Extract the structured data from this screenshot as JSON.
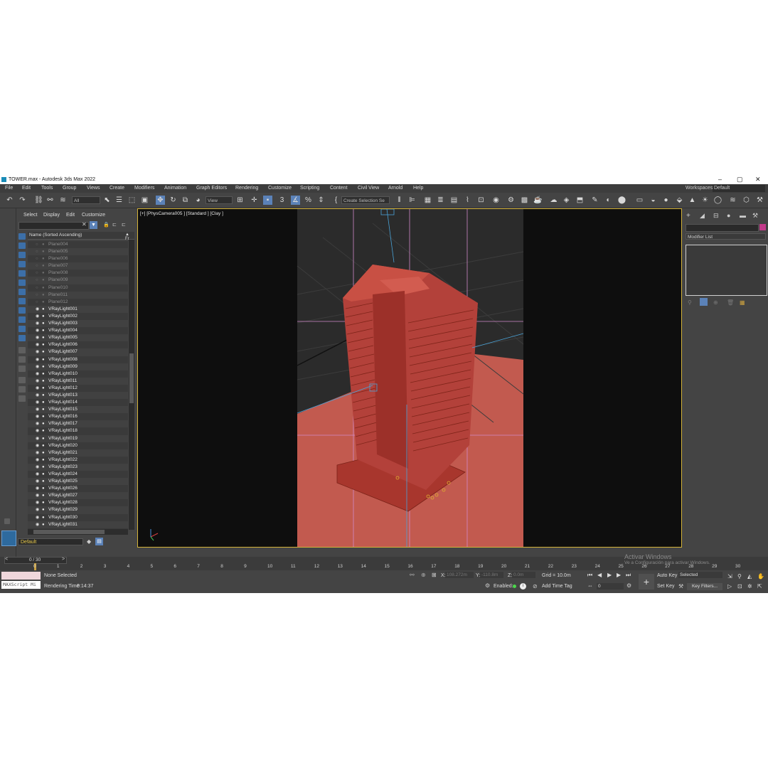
{
  "window": {
    "title": "TOWER.max - Autodesk 3ds Max 2022",
    "controls": [
      "–",
      "▢",
      "✕"
    ]
  },
  "menu": [
    "File",
    "Edit",
    "Tools",
    "Group",
    "Views",
    "Create",
    "Modifiers",
    "Animation",
    "Graph Editors",
    "Rendering",
    "Customize",
    "Scripting",
    "Content",
    "Civil View",
    "Arnold",
    "Help"
  ],
  "workspace": {
    "label": "Workspaces:",
    "value": "Default"
  },
  "toolbar": {
    "selection_filter": "All",
    "ref_coord": "View",
    "named_selection": "Create Selection Se"
  },
  "scene_explorer": {
    "tabs": [
      "Select",
      "Display",
      "Edit",
      "Customize"
    ],
    "column_header": "Name (Sorted Ascending)",
    "column_header_right": "Fr",
    "layer": "Default",
    "items": [
      {
        "name": "Plane004",
        "dim": true
      },
      {
        "name": "Plane005",
        "dim": true
      },
      {
        "name": "Plane006",
        "dim": true
      },
      {
        "name": "Plane007",
        "dim": true
      },
      {
        "name": "Plane008",
        "dim": true
      },
      {
        "name": "Plane009",
        "dim": true
      },
      {
        "name": "Plane010",
        "dim": true
      },
      {
        "name": "Plane011",
        "dim": true
      },
      {
        "name": "Plane012",
        "dim": true
      },
      {
        "name": "VRayLight001"
      },
      {
        "name": "VRayLight002"
      },
      {
        "name": "VRayLight003"
      },
      {
        "name": "VRayLight004"
      },
      {
        "name": "VRayLight005"
      },
      {
        "name": "VRayLight006"
      },
      {
        "name": "VRayLight007"
      },
      {
        "name": "VRayLight008"
      },
      {
        "name": "VRayLight009"
      },
      {
        "name": "VRayLight010"
      },
      {
        "name": "VRayLight011"
      },
      {
        "name": "VRayLight012"
      },
      {
        "name": "VRayLight013"
      },
      {
        "name": "VRayLight014"
      },
      {
        "name": "VRayLight015"
      },
      {
        "name": "VRayLight016"
      },
      {
        "name": "VRayLight017"
      },
      {
        "name": "VRayLight018"
      },
      {
        "name": "VRayLight019"
      },
      {
        "name": "VRayLight020"
      },
      {
        "name": "VRayLight021"
      },
      {
        "name": "VRayLight022"
      },
      {
        "name": "VRayLight023"
      },
      {
        "name": "VRayLight024"
      },
      {
        "name": "VRayLight025"
      },
      {
        "name": "VRayLight026"
      },
      {
        "name": "VRayLight027"
      },
      {
        "name": "VRayLight028"
      },
      {
        "name": "VRayLight029"
      },
      {
        "name": "VRayLight030"
      },
      {
        "name": "VRayLight031"
      }
    ]
  },
  "viewport": {
    "label": "[+] [PhysCamera005 ] [Standard ] [Clay ]"
  },
  "command_panel": {
    "modifier_list": "Modifier List"
  },
  "timeline": {
    "frame_range": "0 / 30",
    "ticks": [
      "0",
      "1",
      "2",
      "3",
      "4",
      "5",
      "6",
      "7",
      "8",
      "9",
      "10",
      "11",
      "12",
      "13",
      "14",
      "15",
      "16",
      "17",
      "18",
      "19",
      "20",
      "21",
      "22",
      "23",
      "24",
      "25",
      "26",
      "27",
      "28",
      "29",
      "30"
    ]
  },
  "status": {
    "maxscript": "MAXScript Mi",
    "selection": "None Selected",
    "render_time_label": "Rendering Time",
    "render_time": "0:14:37",
    "x_label": "X:",
    "x_value": "108.272m",
    "y_label": "Y:",
    "y_value": "-110.8m",
    "z_label": "Z:",
    "z_value": "0.0m",
    "grid": "Grid = 10.0m",
    "enabled_label": "Enabled:",
    "add_time_tag": "Add Time Tag",
    "auto_key": "Auto Key",
    "selected": "Selected",
    "set_key": "Set Key",
    "key_filters": "Key Filters...",
    "frame_field": "0"
  },
  "watermark": {
    "line1": "Activar Windows",
    "line2": "Ve a Configuración para activar Windows."
  },
  "colors": {
    "accent": "#5b82b8",
    "viewport_border": "#d4b33a",
    "model": "#c0473d",
    "ground": "#c25a4f"
  }
}
